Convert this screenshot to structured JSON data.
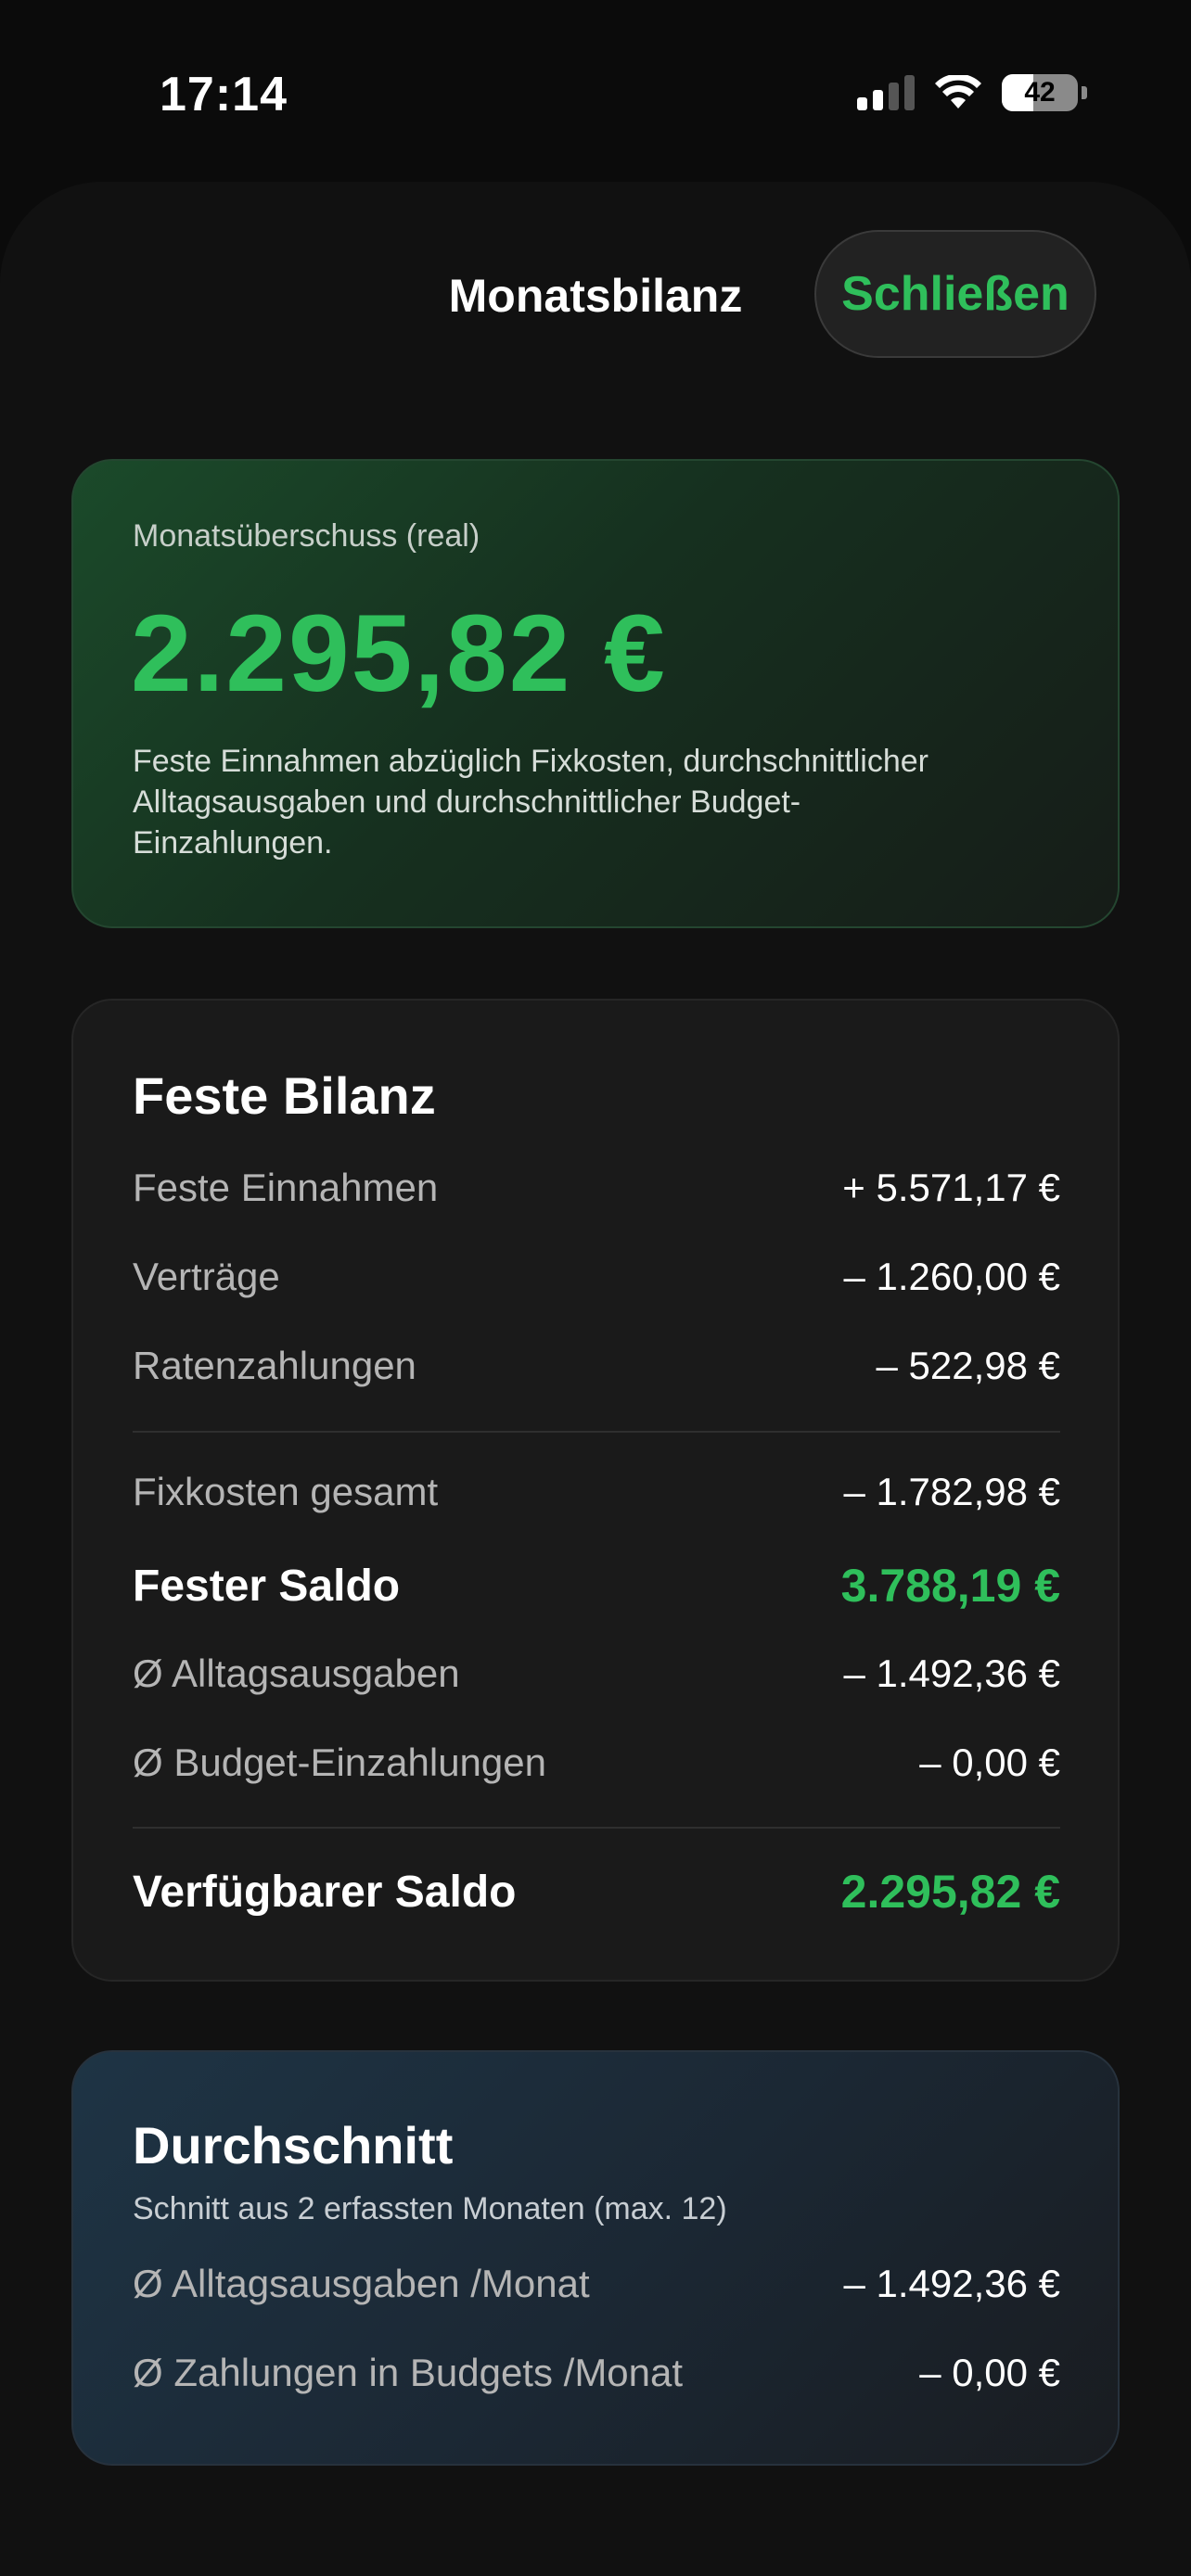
{
  "status_bar": {
    "time": "17:14",
    "battery_level": "42",
    "icons": [
      "cellular-signal-icon",
      "wifi-icon",
      "battery-icon"
    ]
  },
  "sheet": {
    "title": "Monatsbilanz",
    "close_label": "Schließen"
  },
  "hero": {
    "label": "Monatsüberschuss (real)",
    "value": "2.295,82 €",
    "description": "Feste Einnahmen abzüglich Fixkosten, durchschnittlicher Alltagsausgaben und durchschnittlicher Budget-Einzahlungen."
  },
  "fixed_balance": {
    "heading": "Feste Bilanz",
    "rows": [
      {
        "label": "Feste Einnahmen",
        "value": "+ 5.571,17 €"
      },
      {
        "label": "Verträge",
        "value": "– 1.260,00 €"
      },
      {
        "label": "Ratenzahlungen",
        "value": "– 522,98 €"
      },
      {
        "label": "Fixkosten gesamt",
        "value": "– 1.782,98 €"
      },
      {
        "label": "Fester Saldo",
        "value": "3.788,19 €"
      },
      {
        "label": "Ø Alltagsausgaben",
        "value": "– 1.492,36 €"
      },
      {
        "label": "Ø Budget-Einzahlungen",
        "value": "– 0,00 €"
      },
      {
        "label": "Verfügbarer Saldo",
        "value": "2.295,82 €"
      }
    ]
  },
  "average": {
    "heading": "Durchschnitt",
    "subtitle": "Schnitt aus 2 erfassten Monaten (max. 12)",
    "rows": [
      {
        "label": "Ø Alltagsausgaben /Monat",
        "value": "– 1.492,36 €"
      },
      {
        "label": "Ø Zahlungen in Budgets /Monat",
        "value": "– 0,00 €"
      }
    ]
  },
  "colors": {
    "accent_green": "#2fbf5b",
    "background": "#0b0b0b",
    "card": "#1a1a1a"
  }
}
